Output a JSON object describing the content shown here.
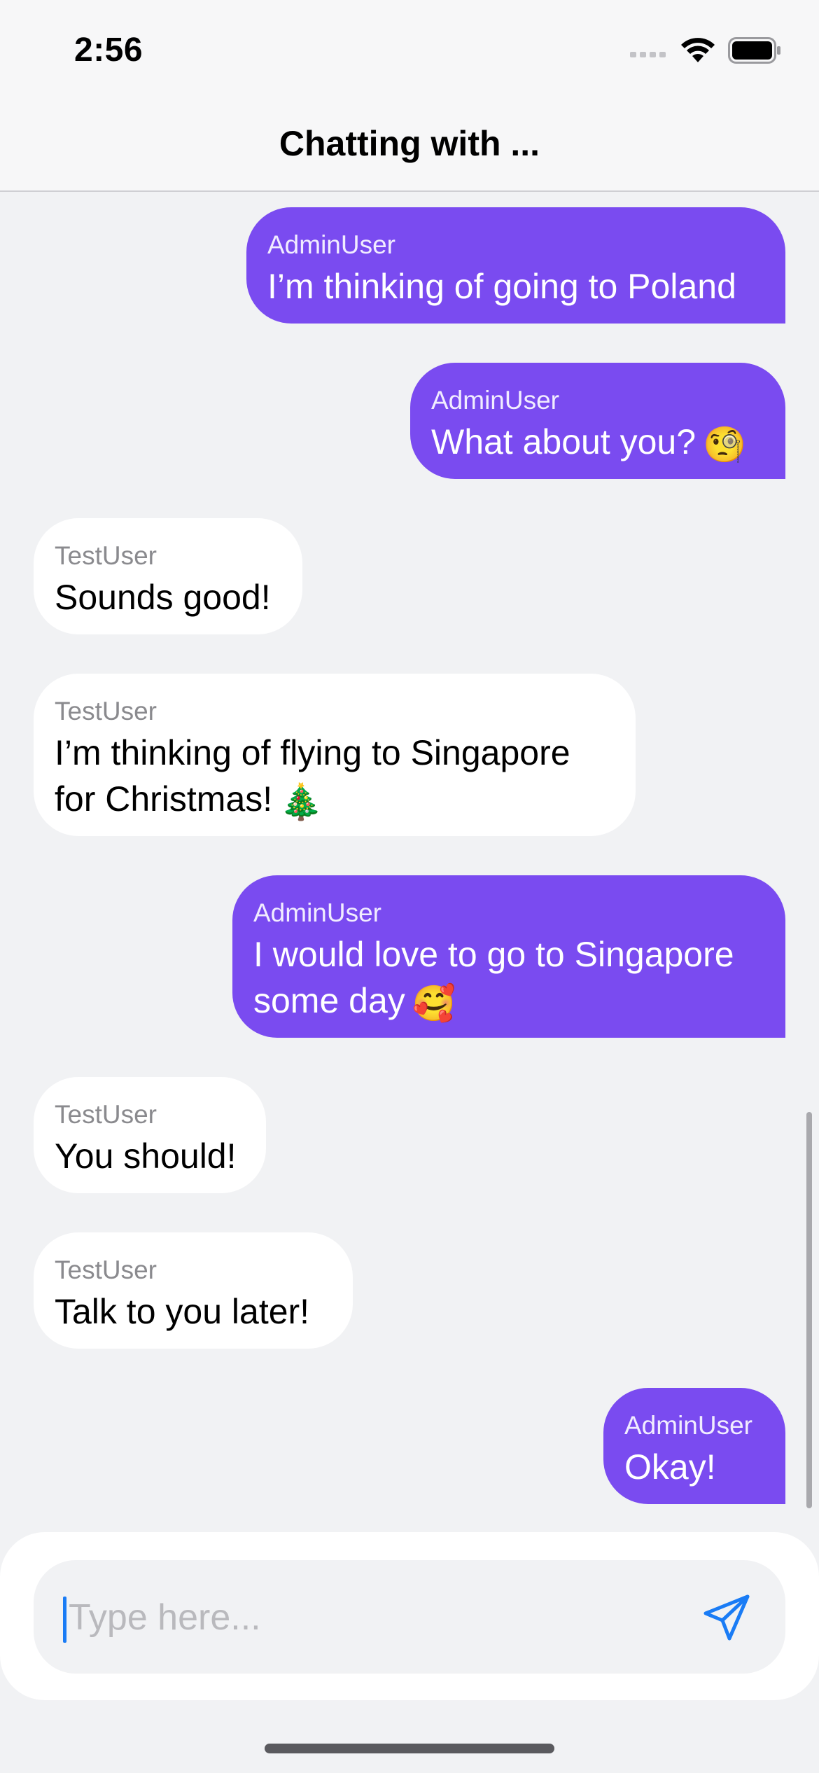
{
  "status_bar": {
    "time": "2:56"
  },
  "nav": {
    "title": "Chatting with ..."
  },
  "messages": [
    {
      "sender": "AdminUser",
      "line1": "I’m thinking of going to Poland",
      "line2": "",
      "emoji": ""
    },
    {
      "sender": "AdminUser",
      "line1": "What about you?",
      "line2": "",
      "emoji": "🧐"
    },
    {
      "sender": "TestUser",
      "line1": "Sounds good!",
      "line2": "",
      "emoji": ""
    },
    {
      "sender": "TestUser",
      "line1": "I’m thinking of flying to Singapore",
      "line2": "for Christmas!",
      "emoji": "🎄"
    },
    {
      "sender": "AdminUser",
      "line1": "I would love to go to Singapore",
      "line2": "some day",
      "emoji": "🥰"
    },
    {
      "sender": "TestUser",
      "line1": "You should!",
      "line2": "",
      "emoji": ""
    },
    {
      "sender": "TestUser",
      "line1": "Talk to you later!",
      "line2": "",
      "emoji": ""
    },
    {
      "sender": "AdminUser",
      "line1": "Okay!",
      "line2": "",
      "emoji": ""
    }
  ],
  "composer": {
    "placeholder": "Type here...",
    "value": ""
  },
  "colors": {
    "outgoing_bubble": "#7a4bf0",
    "incoming_bubble": "#ffffff",
    "accent": "#1a7cf5"
  },
  "icons": [
    "cellular-signal-icon",
    "wifi-icon",
    "battery-icon",
    "paper-plane-send-icon"
  ]
}
